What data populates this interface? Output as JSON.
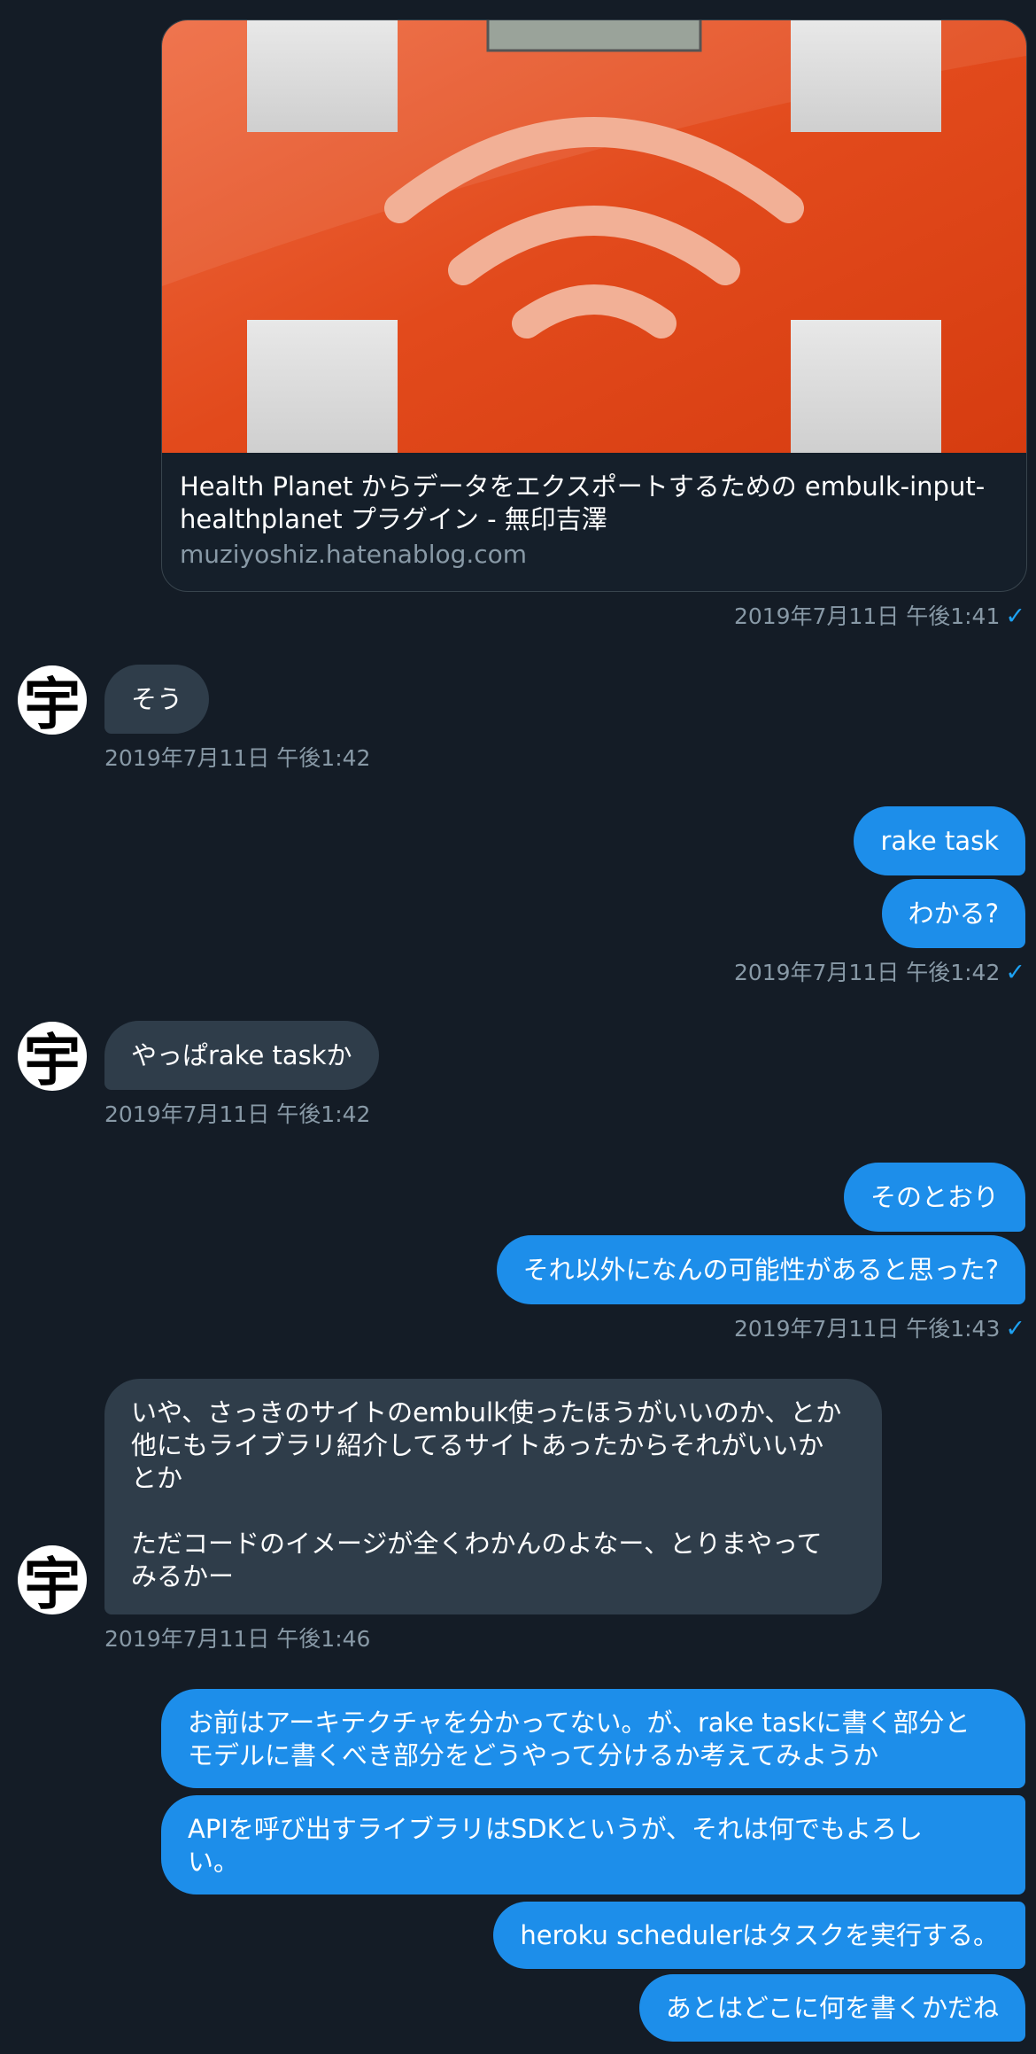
{
  "link_card": {
    "title": "Health Planet からデータをエクスポートするための embulk-input-healthplanet プラグイン - 無印吉澤",
    "url": "muziyoshiz.hatenablog.com"
  },
  "avatar_glyph": "宇",
  "messages": [
    {
      "side": "out",
      "ts": "2019年7月11日 午後1:41"
    },
    {
      "side": "in",
      "text": "そう",
      "ts": "2019年7月11日 午後1:42"
    },
    {
      "side": "out",
      "text": "rake task"
    },
    {
      "side": "out",
      "text": "わかる?",
      "ts": "2019年7月11日 午後1:42"
    },
    {
      "side": "in",
      "text": "やっぱrake taskか",
      "ts": "2019年7月11日 午後1:42"
    },
    {
      "side": "out",
      "text": "そのとおり"
    },
    {
      "side": "out",
      "text": "それ以外になんの可能性があると思った?",
      "ts": "2019年7月11日 午後1:43"
    },
    {
      "side": "in",
      "text": "いや、さっきのサイトのembulk使ったほうがいいのか、とか\n他にもライブラリ紹介してるサイトあったからそれがいいか\nとか\n\nただコードのイメージが全くわかんのよなー、とりまやって\nみるかー",
      "ts": "2019年7月11日 午後1:46"
    },
    {
      "side": "out",
      "text": "お前はアーキテクチャを分かってない。が、rake taskに書く部分と\nモデルに書くべき部分をどうやって分けるか考えてみようか"
    },
    {
      "side": "out",
      "text": "APIを呼び出すライブラリはSDKというが、それは何でもよろし\nい。"
    },
    {
      "side": "out",
      "text": "heroku schedulerはタスクを実行する。"
    },
    {
      "side": "out",
      "text": "あとはどこに何を書くかだね"
    }
  ],
  "colors": {
    "background": "#141c26",
    "incoming": "#2f3d4a",
    "outgoing": "#1d8eea",
    "card_orange": "#e8431a"
  },
  "icons": {
    "read_receipt": "checkmark-icon"
  }
}
